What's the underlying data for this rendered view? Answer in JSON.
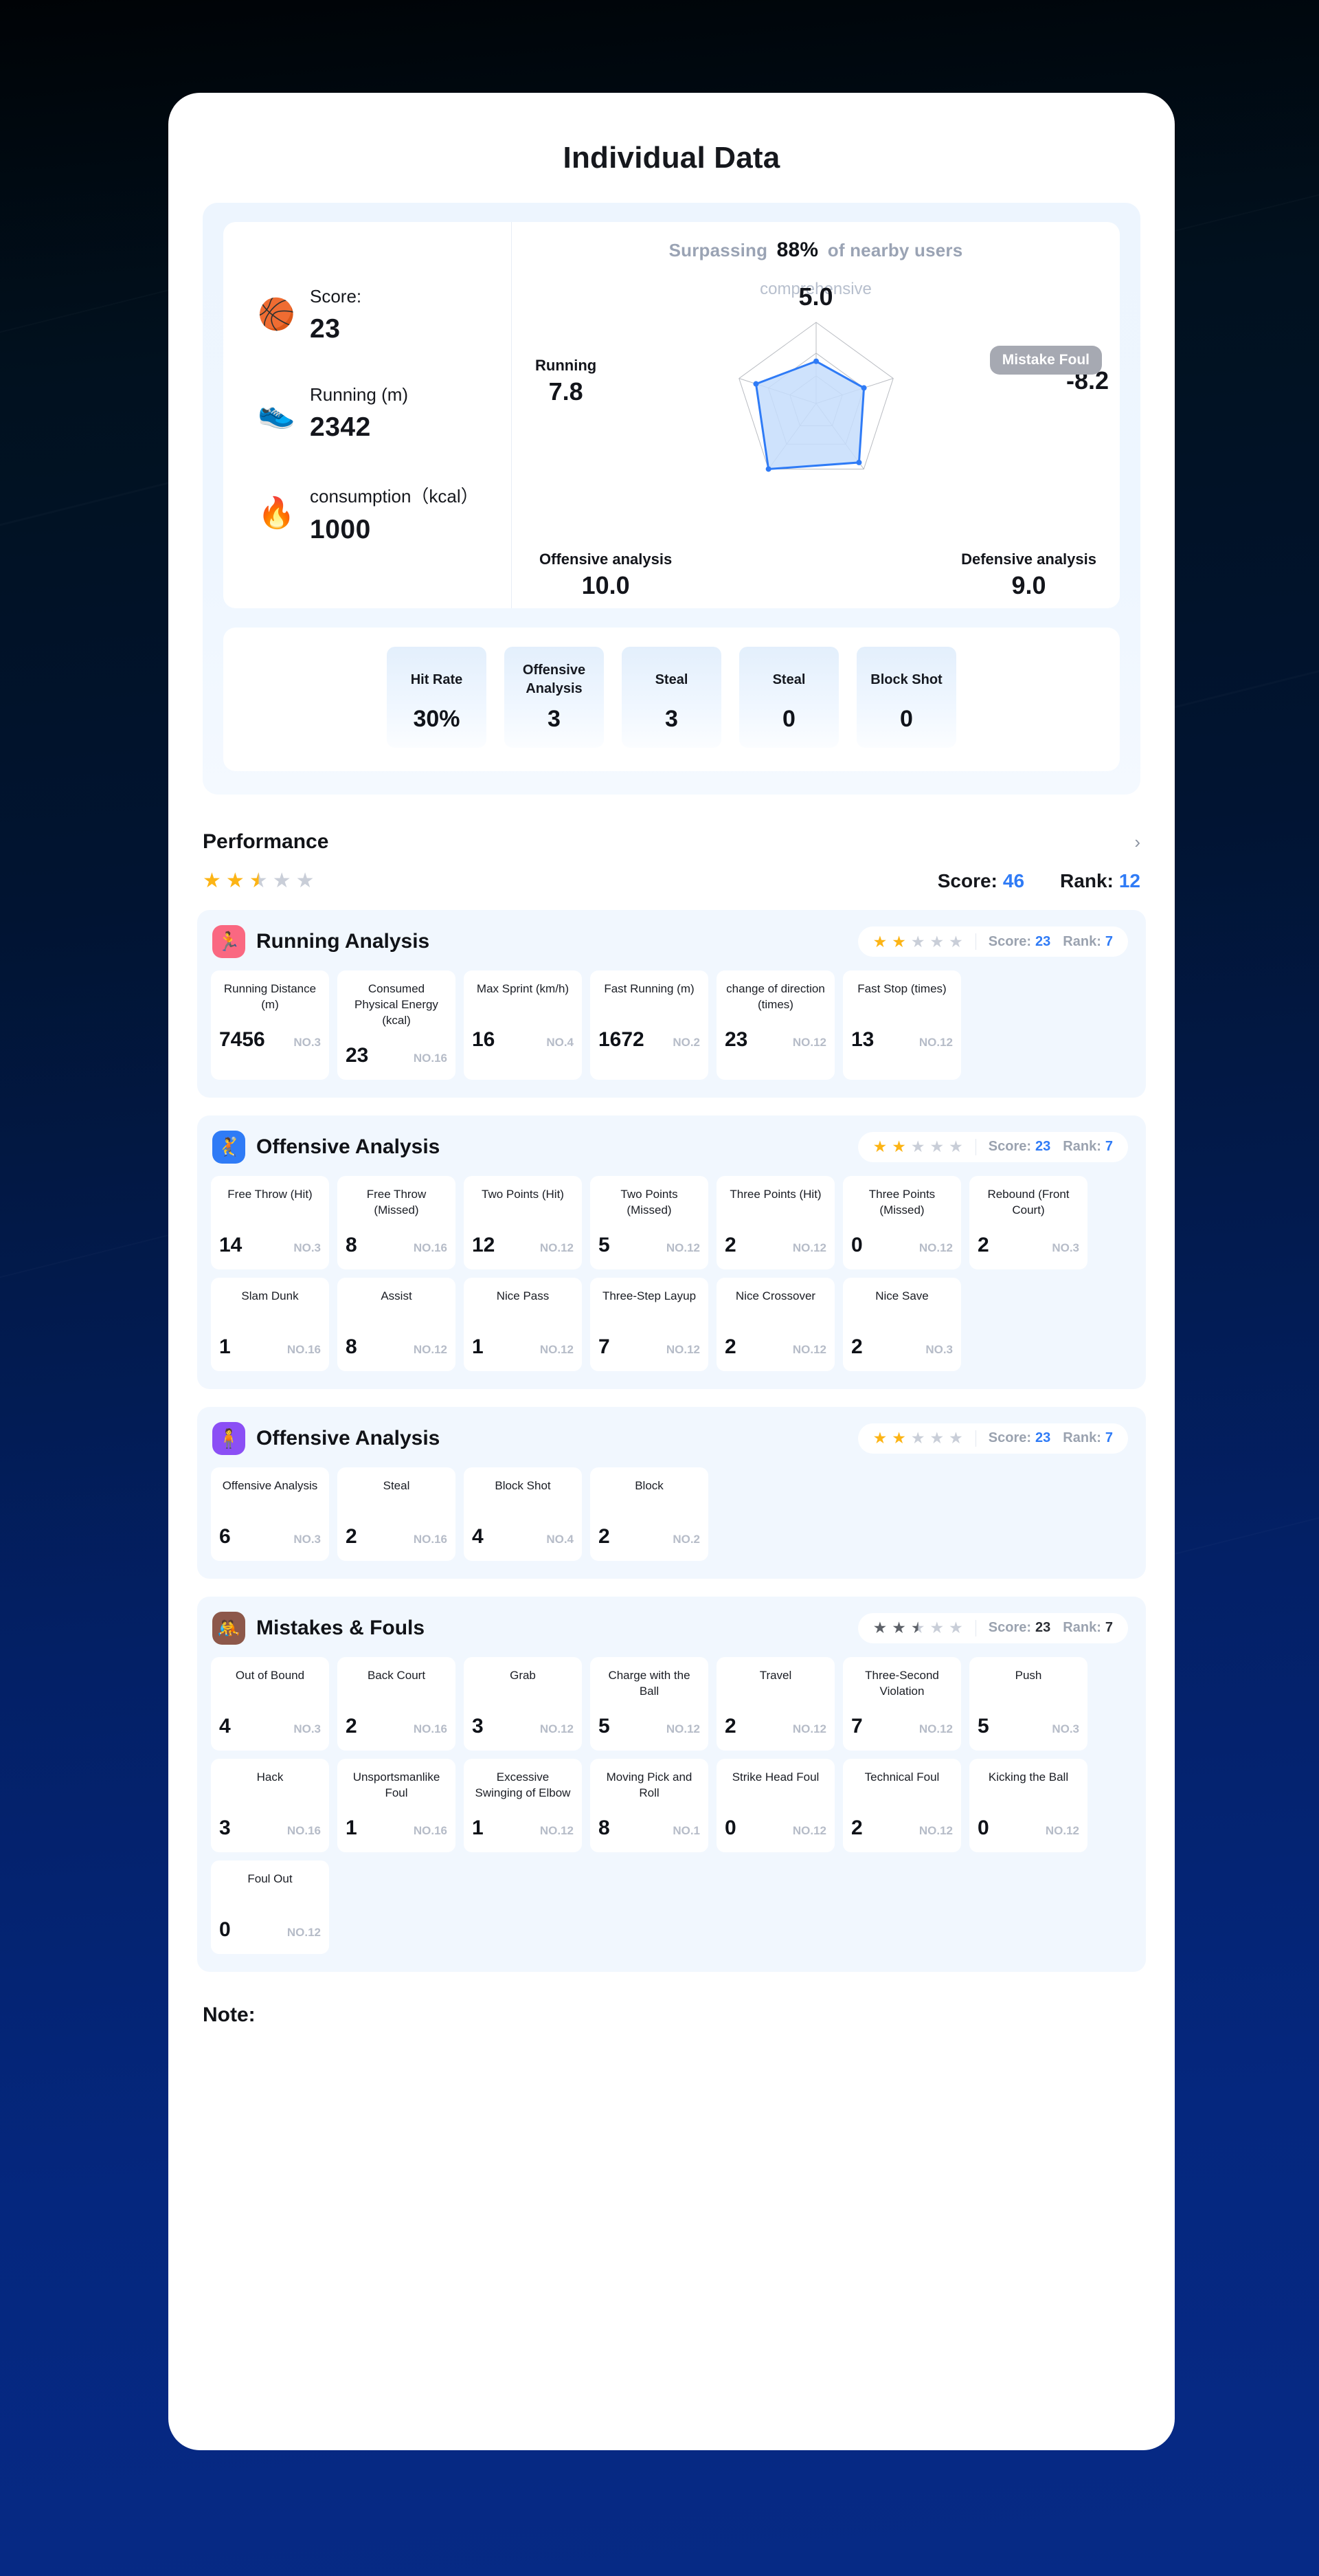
{
  "page_title": "Individual Data",
  "summary": {
    "stats": [
      {
        "icon": "basketball-icon",
        "glyph": "🏀",
        "label": "Score:",
        "value": "23"
      },
      {
        "icon": "running-shoe-icon",
        "glyph": "👟",
        "label": "Running (m)",
        "value": "2342"
      },
      {
        "icon": "flame-icon",
        "glyph": "🔥",
        "label": "consumption（kcal）",
        "value": "1000"
      }
    ],
    "surpass_prefix": "Surpassing",
    "surpass_value": "88%",
    "surpass_suffix": "of nearby users",
    "comprehensive": "comprehensive",
    "tooltip": "Mistake  Foul"
  },
  "chart_data": {
    "type": "radar",
    "title": "comprehensive",
    "axes": [
      "comprehensive",
      "Mistake Foul",
      "Defensive analysis",
      "Offensive analysis",
      "Running"
    ],
    "labels": [
      "5.0",
      "-8.2",
      "9.0",
      "10.0",
      "7.8"
    ],
    "values": [
      5.0,
      -8.2,
      9.0,
      10.0,
      7.8
    ],
    "normalized": [
      0.52,
      0.62,
      0.9,
      1.0,
      0.78
    ],
    "max": 10,
    "series": [
      {
        "name": "comprehensive",
        "values": [
          5.0,
          -8.2,
          9.0,
          10.0,
          7.8
        ]
      }
    ],
    "accent": "#2f7bf6",
    "fill": "#c6ddfb",
    "grid": true,
    "legend": false
  },
  "kpis": [
    {
      "label": "Hit Rate",
      "value": "30%"
    },
    {
      "label": "Offensive Analysis",
      "value": "3"
    },
    {
      "label": "Steal",
      "value": "3"
    },
    {
      "label": "Steal",
      "value": "0"
    },
    {
      "label": "Block Shot",
      "value": "0"
    }
  ],
  "performance": {
    "title": "Performance",
    "chevron": "›",
    "stars": 2.5,
    "score_label": "Score:",
    "score_value": "46",
    "rank_label": "Rank:",
    "rank_value": "12"
  },
  "sections": [
    {
      "name": "Running Analysis",
      "icon": "running-person-icon",
      "glyph": "🏃",
      "color": "#fa6881",
      "stars": 2,
      "gray_stars": false,
      "score_label": "Score:",
      "score_value": "23",
      "rank_label": "Rank:",
      "rank_value": "7",
      "cells": [
        {
          "label": "Running Distance (m)",
          "value": "7456",
          "no": "NO.3"
        },
        {
          "label": "Consumed Physical Energy (kcal)",
          "value": "23",
          "no": "NO.16"
        },
        {
          "label": "Max Sprint (km/h)",
          "value": "16",
          "no": "NO.4"
        },
        {
          "label": "Fast Running (m)",
          "value": "1672",
          "no": "NO.2"
        },
        {
          "label": "change of direction (times)",
          "value": "23",
          "no": "NO.12"
        },
        {
          "label": "Fast Stop (times)",
          "value": "13",
          "no": "NO.12"
        }
      ]
    },
    {
      "name": "Offensive Analysis",
      "icon": "offense-person-icon",
      "glyph": "🤾",
      "color": "#2f7bf6",
      "stars": 2,
      "gray_stars": false,
      "score_label": "Score:",
      "score_value": "23",
      "rank_label": "Rank:",
      "rank_value": "7",
      "cells": [
        {
          "label": "Free Throw (Hit)",
          "value": "14",
          "no": "NO.3"
        },
        {
          "label": "Free Throw (Missed)",
          "value": "8",
          "no": "NO.16"
        },
        {
          "label": "Two Points (Hit)",
          "value": "12",
          "no": "NO.12"
        },
        {
          "label": "Two Points (Missed)",
          "value": "5",
          "no": "NO.12"
        },
        {
          "label": "Three Points (Hit)",
          "value": "2",
          "no": "NO.12"
        },
        {
          "label": "Three Points (Missed)",
          "value": "0",
          "no": "NO.12"
        },
        {
          "label": "Rebound (Front Court)",
          "value": "2",
          "no": "NO.3"
        },
        {
          "label": "Slam Dunk",
          "value": "1",
          "no": "NO.16"
        },
        {
          "label": "Assist",
          "value": "8",
          "no": "NO.12"
        },
        {
          "label": "Nice Pass",
          "value": "1",
          "no": "NO.12"
        },
        {
          "label": "Three-Step Layup",
          "value": "7",
          "no": "NO.12"
        },
        {
          "label": "Nice Crossover",
          "value": "2",
          "no": "NO.12"
        },
        {
          "label": "Nice Save",
          "value": "2",
          "no": "NO.3"
        }
      ]
    },
    {
      "name": "Offensive Analysis",
      "icon": "defense-person-icon",
      "glyph": "🧍",
      "color": "#8b4ff5",
      "stars": 2,
      "gray_stars": false,
      "score_label": "Score:",
      "score_value": "23",
      "rank_label": "Rank:",
      "rank_value": "7",
      "cells": [
        {
          "label": "Offensive Analysis",
          "value": "6",
          "no": "NO.3"
        },
        {
          "label": "Steal",
          "value": "2",
          "no": "NO.16"
        },
        {
          "label": "Block Shot",
          "value": "4",
          "no": "NO.4"
        },
        {
          "label": "Block",
          "value": "2",
          "no": "NO.2"
        }
      ]
    },
    {
      "name": "Mistakes & Fouls",
      "icon": "foul-person-icon",
      "glyph": "🤼",
      "color": "#8d584a",
      "stars": 2.5,
      "gray_stars": true,
      "score_label": "Score:",
      "score_value": "23",
      "rank_label": "Rank:",
      "rank_value": "7",
      "cells": [
        {
          "label": "Out of Bound",
          "value": "4",
          "no": "NO.3"
        },
        {
          "label": "Back Court",
          "value": "2",
          "no": "NO.16"
        },
        {
          "label": "Grab",
          "value": "3",
          "no": "NO.12"
        },
        {
          "label": "Charge with the Ball",
          "value": "5",
          "no": "NO.12"
        },
        {
          "label": "Travel",
          "value": "2",
          "no": "NO.12"
        },
        {
          "label": "Three-Second Violation",
          "value": "7",
          "no": "NO.12"
        },
        {
          "label": "Push",
          "value": "5",
          "no": "NO.3"
        },
        {
          "label": "Hack",
          "value": "3",
          "no": "NO.16"
        },
        {
          "label": "Unsportsmanlike Foul",
          "value": "1",
          "no": "NO.16"
        },
        {
          "label": "Excessive Swinging of Elbow",
          "value": "1",
          "no": "NO.12"
        },
        {
          "label": "Moving Pick and Roll",
          "value": "8",
          "no": "NO.1"
        },
        {
          "label": "Strike Head Foul",
          "value": "0",
          "no": "NO.12"
        },
        {
          "label": "Technical Foul",
          "value": "2",
          "no": "NO.12"
        },
        {
          "label": "Kicking the Ball",
          "value": "0",
          "no": "NO.12"
        },
        {
          "label": "Foul Out",
          "value": "0",
          "no": "NO.12"
        }
      ]
    }
  ],
  "note": "Note:"
}
